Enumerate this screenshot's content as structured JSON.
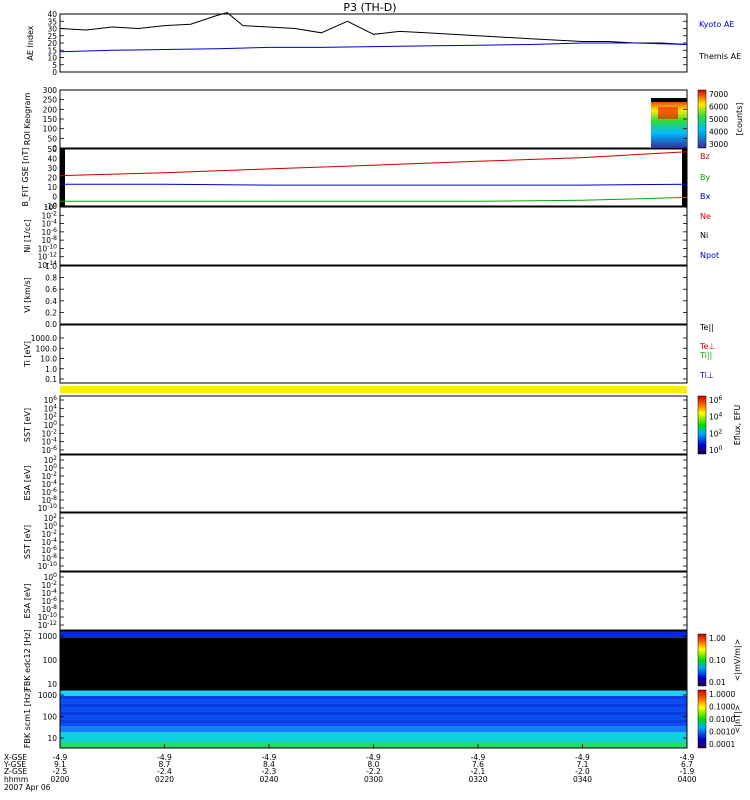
{
  "title": "P3 (TH-D)",
  "chart_data": {
    "type": "line",
    "x_tick_labels": [
      "0200",
      "0220",
      "0240",
      "0300",
      "0320",
      "0340",
      "0400"
    ],
    "ephemeris": {
      "row_labels": [
        "X-GSE",
        "Y-GSE",
        "Z-GSE",
        "hhmm",
        "2007 Apr 06"
      ],
      "x_gse": [
        "-4.9",
        "-4.9",
        "-4.9",
        "-4.9",
        "-4.9",
        "-4.9",
        "-4.9"
      ],
      "y_gse": [
        "9.1",
        "8.7",
        "8.4",
        "8.0",
        "7.6",
        "7.1",
        "6.7"
      ],
      "z_gse": [
        "-2.5",
        "-2.4",
        "-2.3",
        "-2.2",
        "-2.1",
        "-2.0",
        "-1.9"
      ]
    },
    "panels": [
      {
        "id": "ae",
        "ylabel": "AE Index",
        "ylim": [
          0,
          40
        ],
        "yticks": [
          "0",
          "5",
          "10",
          "15",
          "20",
          "25",
          "30",
          "35",
          "40"
        ],
        "legend": [
          {
            "name": "Kyoto AE",
            "color": "#0000cc"
          },
          {
            "name": "Themis AE",
            "color": "#000000"
          }
        ],
        "series": [
          {
            "name": "kyoto",
            "color": "#000000",
            "x": [
              0,
              5,
              10,
              15,
              20,
              25,
              30,
              32,
              35,
              40,
              45,
              50,
              55,
              60,
              65,
              70,
              75,
              80,
              85,
              90,
              95,
              100,
              105,
              110,
              115,
              120
            ],
            "y": [
              30,
              29,
              31,
              30,
              32,
              33,
              39,
              41,
              32,
              31,
              30,
              27,
              35,
              26,
              28,
              27,
              26,
              25,
              24,
              23,
              22,
              21,
              21,
              20,
              20,
              19
            ]
          },
          {
            "name": "themis",
            "color": "#0000cc",
            "x": [
              0,
              10,
              20,
              30,
              40,
              50,
              60,
              70,
              80,
              90,
              100,
              110,
              120
            ],
            "y": [
              14,
              15,
              15.5,
              16,
              17,
              17,
              17.5,
              18,
              18.5,
              19,
              20,
              20,
              19
            ]
          }
        ]
      },
      {
        "id": "keogram",
        "ylabel": "ROI Keogram",
        "ylim": [
          0,
          300
        ],
        "yticks": [
          "0",
          "50",
          "100",
          "150",
          "200",
          "250",
          "300"
        ],
        "colorbar": {
          "label": "[counts]",
          "ticks": [
            "3000",
            "4000",
            "5000",
            "6000",
            "7000"
          ]
        }
      },
      {
        "id": "bfit",
        "ylabel": "B_FIT GSE [nT]",
        "ylim": [
          -10,
          50
        ],
        "yticks": [
          "-10",
          "0",
          "10",
          "20",
          "30",
          "40",
          "50"
        ],
        "legend": [
          {
            "name": "Bz",
            "color": "#cc0000"
          },
          {
            "name": "By",
            "color": "#00aa00"
          },
          {
            "name": "Bx",
            "color": "#0000cc"
          }
        ],
        "series": [
          {
            "name": "Bz",
            "color": "#cc0000",
            "x": [
              0,
              20,
              40,
              60,
              80,
              100,
              120
            ],
            "y": [
              22,
              25,
              29,
              33,
              37,
              41,
              47
            ]
          },
          {
            "name": "By",
            "color": "#00aa00",
            "x": [
              0,
              20,
              40,
              60,
              80,
              100,
              120
            ],
            "y": [
              -5,
              -5,
              -5,
              -5,
              -5,
              -4,
              -1
            ]
          },
          {
            "name": "Bx",
            "color": "#0000cc",
            "x": [
              0,
              20,
              40,
              60,
              80,
              100,
              120
            ],
            "y": [
              13,
              13,
              12,
              12,
              12,
              12,
              13
            ]
          }
        ]
      },
      {
        "id": "ni",
        "ylabel": "Ni [1/cc]",
        "ylim": [
          -14,
          0
        ],
        "yticks": [
          "10^0",
          "10^-2",
          "10^-4",
          "10^-6",
          "10^-8",
          "10^-10",
          "10^-12",
          "10^-14"
        ],
        "legend": [
          {
            "name": "Ne",
            "color": "#cc0000"
          },
          {
            "name": "Ni",
            "color": "#000000"
          },
          {
            "name": "Npot",
            "color": "#0000cc"
          }
        ]
      },
      {
        "id": "vi",
        "ylabel": "Vi [km/s]",
        "ylim": [
          0,
          1
        ],
        "yticks": [
          "0.0",
          "0.2",
          "0.4",
          "0.6",
          "0.8",
          "1.0"
        ]
      },
      {
        "id": "ti",
        "ylabel": "Ti [eV]",
        "ylim": [
          0.1,
          1000
        ],
        "yticks": [
          "0.1",
          "1.0",
          "10.0",
          "100.0",
          "1000.0"
        ],
        "legend": [
          {
            "name": "Te||",
            "color": "#000000"
          },
          {
            "name": "Te⊥",
            "color": "#cc0000"
          },
          {
            "name": "Ti||",
            "color": "#00aa00"
          },
          {
            "name": "Ti⊥",
            "color": "#0000cc"
          }
        ]
      },
      {
        "id": "sst_i",
        "ylabel": "SST [eV]",
        "yticks": [
          "10^6",
          "10^4",
          "10^2",
          "10^0",
          "10^-2",
          "10^-4",
          "10^-6"
        ],
        "colorbar": {
          "label": "Eflux, EFU",
          "ticks": [
            "10^6",
            "10^4",
            "10^2",
            "10^0"
          ]
        }
      },
      {
        "id": "esa_i",
        "ylabel": "ESA [eV]",
        "yticks": [
          "10^2",
          "10^0",
          "10^-2",
          "10^-4",
          "10^-6",
          "10^-8",
          "10^-10"
        ]
      },
      {
        "id": "sst_e",
        "ylabel": "SST [eV]",
        "yticks": [
          "10^2",
          "10^0",
          "10^-2",
          "10^-4",
          "10^-6",
          "10^-8",
          "10^-10"
        ]
      },
      {
        "id": "esa_e",
        "ylabel": "ESA [eV]",
        "yticks": [
          "10^0",
          "10^-2",
          "10^-4",
          "10^-6",
          "10^-8",
          "10^-10",
          "10^-12"
        ]
      },
      {
        "id": "fbk_edc",
        "ylabel": "FBK edc12 [Hz]",
        "yticks": [
          "1000",
          "100",
          "10"
        ],
        "colorbar": {
          "label": "<|mV/m|>",
          "ticks": [
            "1.00",
            "0.10",
            "0.01"
          ]
        }
      },
      {
        "id": "fbk_scm",
        "ylabel": "FBK scm1 [Hz]",
        "yticks": [
          "1000",
          "100",
          "10"
        ],
        "colorbar": {
          "label": "<|nT|>",
          "ticks": [
            "1.0000",
            "0.1000",
            "0.0100",
            "0.0010",
            "0.0001"
          ]
        }
      }
    ]
  }
}
